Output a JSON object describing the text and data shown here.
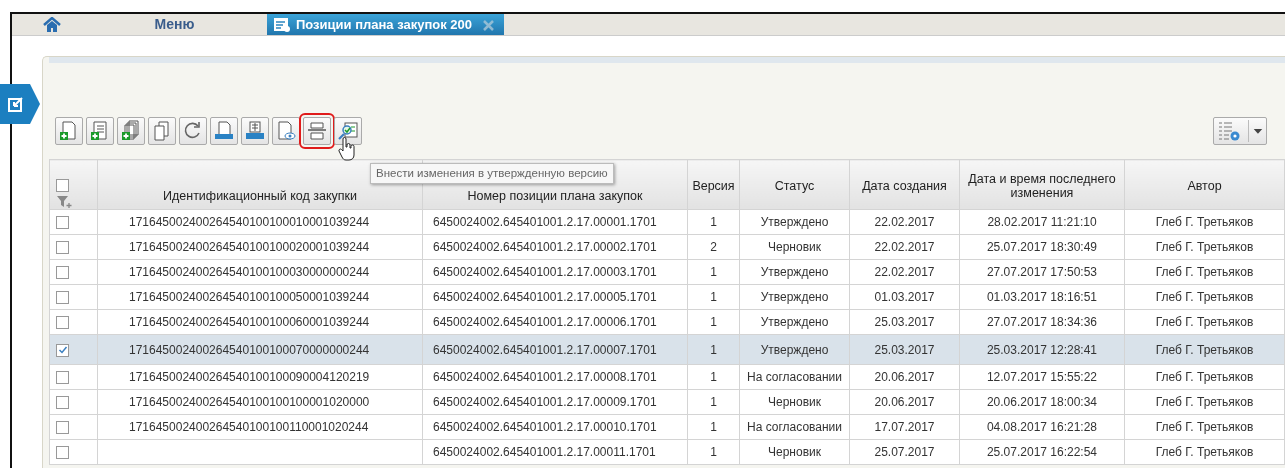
{
  "tabs": [
    {
      "kind": "home",
      "selected": false
    },
    {
      "kind": "text",
      "label": "Меню",
      "selected": false
    },
    {
      "kind": "doc",
      "label": "Позиции плана закупок 200",
      "selected": true
    }
  ],
  "toolbar": {
    "buttons": [
      {
        "kind": "add-doc",
        "highlighted": false
      },
      {
        "kind": "add-list",
        "highlighted": false
      },
      {
        "kind": "add-copies",
        "highlighted": false
      },
      {
        "kind": "copy",
        "highlighted": false
      },
      {
        "kind": "refresh",
        "highlighted": false
      },
      {
        "kind": "print",
        "highlighted": false
      },
      {
        "kind": "print-table",
        "highlighted": false
      },
      {
        "kind": "preview",
        "highlighted": false
      },
      {
        "kind": "edit-version",
        "highlighted": true
      },
      {
        "kind": "search-check",
        "highlighted": false
      }
    ],
    "tooltip": "Внести изменения в утвержденную версию"
  },
  "table": {
    "select_all_checked": false,
    "columns": [
      "Идентификационный код закупки",
      "Номер позиции плана закупок",
      "Версия",
      "Статус",
      "Дата создания",
      "Дата и время последнего изменения",
      "Автор"
    ],
    "rows": [
      {
        "selected": false,
        "cells": [
          "171645002400264540100100010001039244",
          "6450024002.645401001.2.17.00001.1701",
          "1",
          "Утверждено",
          "22.02.2017",
          "28.02.2017 11:21:10",
          "Глеб Г. Третьяков"
        ]
      },
      {
        "selected": false,
        "cells": [
          "171645002400264540100100020001039244",
          "6450024002.645401001.2.17.00002.1701",
          "2",
          "Черновик",
          "22.02.2017",
          "25.07.2017 18:30:49",
          "Глеб Г. Третьяков"
        ]
      },
      {
        "selected": false,
        "cells": [
          "171645002400264540100100030000000244",
          "6450024002.645401001.2.17.00003.1701",
          "1",
          "Утверждено",
          "22.02.2017",
          "27.07.2017 17:50:53",
          "Глеб Г. Третьяков"
        ]
      },
      {
        "selected": false,
        "cells": [
          "171645002400264540100100050001039244",
          "6450024002.645401001.2.17.00005.1701",
          "1",
          "Утверждено",
          "01.03.2017",
          "01.03.2017 18:16:51",
          "Глеб Г. Третьяков"
        ]
      },
      {
        "selected": false,
        "cells": [
          "171645002400264540100100060001039244",
          "6450024002.645401001.2.17.00006.1701",
          "1",
          "Утверждено",
          "25.03.2017",
          "27.07.2017 18:34:36",
          "Глеб Г. Третьяков"
        ]
      },
      {
        "selected": true,
        "cells": [
          "171645002400264540100100070000000244",
          "6450024002.645401001.2.17.00007.1701",
          "1",
          "Утверждено",
          "25.03.2017",
          "25.03.2017 12:28:41",
          "Глеб Г. Третьяков"
        ]
      },
      {
        "selected": false,
        "cells": [
          "171645002400264540100100090004120219",
          "6450024002.645401001.2.17.00008.1701",
          "1",
          "На согласовании",
          "20.06.2017",
          "12.07.2017 15:55:22",
          "Глеб Г. Третьяков"
        ]
      },
      {
        "selected": false,
        "cells": [
          "171645002400264540100100100001020000",
          "6450024002.645401001.2.17.00009.1701",
          "1",
          "Черновик",
          "20.06.2017",
          "20.06.2017 18:00:34",
          "Глеб Г. Третьяков"
        ]
      },
      {
        "selected": false,
        "cells": [
          "171645002400264540100100110001020244",
          "6450024002.645401001.2.17.00010.1701",
          "1",
          "На согласовании",
          "17.07.2017",
          "04.08.2017 16:21:28",
          "Глеб Г. Третьяков"
        ]
      },
      {
        "selected": false,
        "cells": [
          "",
          "6450024002.645401001.2.17.00011.1701",
          "1",
          "Черновик",
          "25.07.2017",
          "25.07.2017 16:22:54",
          "Глеб Г. Третьяков"
        ]
      }
    ]
  }
}
